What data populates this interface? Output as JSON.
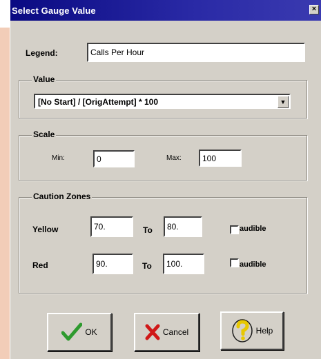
{
  "window": {
    "title": "Select Gauge Value",
    "close_glyph": "×"
  },
  "legend": {
    "label": "Legend:",
    "value": "Calls Per Hour"
  },
  "value_group": {
    "title": "Value",
    "selected": "[No Start] / [OrigAttempt] * 100"
  },
  "scale_group": {
    "title": "Scale",
    "min_label": "Min:",
    "min_value": "0",
    "max_label": "Max:",
    "max_value": "100"
  },
  "caution_group": {
    "title": "Caution Zones",
    "yellow": {
      "label": "Yellow",
      "from": "70.",
      "to_label": "To",
      "to": "80.",
      "audible_label": "audible"
    },
    "red": {
      "label": "Red",
      "from": "90.",
      "to_label": "To",
      "to": "100.",
      "audible_label": "audible"
    }
  },
  "buttons": {
    "ok_label": "OK",
    "cancel_label": "Cancel",
    "help_label": "Help"
  },
  "icons": {
    "ok": "checkmark-icon",
    "cancel": "x-icon",
    "help": "question-mark-icon",
    "close": "close-icon"
  },
  "colors": {
    "titlebar": "#0a0a82",
    "dialog": "#d4d0c8",
    "background": "#f6d7c6",
    "check": "#2e9a2e",
    "x": "#d01818",
    "help": "#e8c800"
  }
}
